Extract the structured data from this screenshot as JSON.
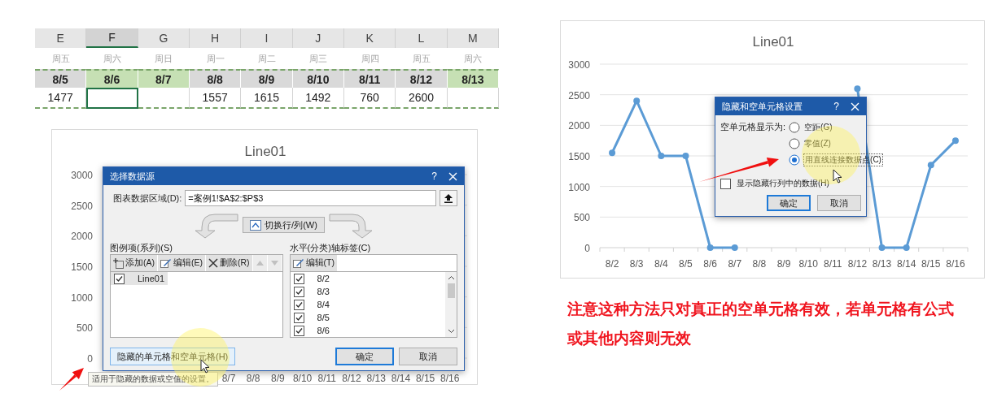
{
  "sheet": {
    "columns": [
      {
        "letter": "E",
        "weekday": "周五",
        "date": "8/5",
        "value": "1477",
        "color": "#d9d9d9",
        "selected": false
      },
      {
        "letter": "F",
        "weekday": "周六",
        "date": "8/6",
        "color": "#c6e0b4",
        "selected": true
      },
      {
        "letter": "G",
        "weekday": "周日",
        "date": "8/7",
        "color": "#c6e0b4",
        "selected": false
      },
      {
        "letter": "H",
        "weekday": "周一",
        "date": "8/8",
        "value": "1557",
        "color": "#d9d9d9",
        "selected": false
      },
      {
        "letter": "I",
        "weekday": "周二",
        "date": "8/9",
        "value": "1615",
        "color": "#d9d9d9",
        "selected": false
      },
      {
        "letter": "J",
        "weekday": "周三",
        "date": "8/10",
        "value": "1492",
        "color": "#d9d9d9",
        "selected": false
      },
      {
        "letter": "K",
        "weekday": "周四",
        "date": "8/11",
        "value": "760",
        "color": "#d9d9d9",
        "selected": false
      },
      {
        "letter": "L",
        "weekday": "周五",
        "date": "8/12",
        "value": "2600",
        "color": "#d9d9d9",
        "selected": false
      },
      {
        "letter": "M",
        "weekday": "周六",
        "date": "8/13",
        "color": "#c6e0b4",
        "selected": false
      }
    ]
  },
  "left_chart": {
    "title": "Line01",
    "y_labels": [
      "3000",
      "2500",
      "2000",
      "1500",
      "1000",
      "500",
      "0"
    ],
    "x_labels": [
      "8/7",
      "8/8",
      "8/9",
      "8/10",
      "8/11",
      "8/12",
      "8/13",
      "8/14",
      "8/15",
      "8/16"
    ]
  },
  "data_source_dialog": {
    "title": "选择数据源",
    "help": "?",
    "range_label": "图表数据区域(D):",
    "range_value": "=案例1!$A$2:$P$3",
    "switch_button": "切换行/列(W)",
    "series_heading": "图例项(系列)(S)",
    "series_buttons": [
      {
        "kind": "add",
        "label": "添加(A)",
        "disabled": false
      },
      {
        "kind": "edit",
        "label": "编辑(E)",
        "disabled": false
      },
      {
        "kind": "delete",
        "label": "删除(R)",
        "disabled": false
      },
      {
        "kind": "up",
        "disabled": true
      },
      {
        "kind": "down",
        "disabled": true
      }
    ],
    "series": [
      {
        "name": "Line01",
        "checked": true,
        "selected": true
      }
    ],
    "axis_heading": "水平(分类)轴标签(C)",
    "axis_buttons": [
      {
        "kind": "edit",
        "label": "编辑(T)",
        "disabled": false
      }
    ],
    "axis_labels": [
      {
        "label": "8/2",
        "checked": true
      },
      {
        "label": "8/3",
        "checked": true
      },
      {
        "label": "8/4",
        "checked": true
      },
      {
        "label": "8/5",
        "checked": true
      },
      {
        "label": "8/6",
        "checked": true
      }
    ],
    "hidden_cells_button": "隐藏的单元格和空单元格(H)",
    "ok": "确定",
    "cancel": "取消",
    "tooltip": "适用于隐藏的数据或空值的设置。"
  },
  "right_chart": {
    "chart_data": {
      "type": "line",
      "title": "Line01",
      "categories": [
        "8/2",
        "8/3",
        "8/4",
        "8/5",
        "8/6",
        "8/7",
        "8/8",
        "8/9",
        "8/10",
        "8/11",
        "8/12",
        "8/13",
        "8/14",
        "8/15",
        "8/16"
      ],
      "series": [
        {
          "color": "#5b9bd5",
          "marker": "circle",
          "values": [
            1550,
            2400,
            1500,
            1500,
            0,
            0,
            null,
            null,
            null,
            null,
            2600,
            0,
            0,
            1350,
            1750
          ]
        }
      ],
      "ylim": [
        0,
        3000
      ],
      "yticks": [
        0,
        500,
        1000,
        1500,
        2000,
        2500,
        3000
      ],
      "grid": true
    }
  },
  "hidden_cells_dialog": {
    "title": "隐藏和空单元格设置",
    "help": "?",
    "show_as_label": "空单元格显示为:",
    "options": [
      {
        "label": "空距(G)",
        "selected": false
      },
      {
        "label": "零值(Z)",
        "selected": false
      },
      {
        "label": "用直线连接数据点(C)",
        "selected": true
      }
    ],
    "show_hidden": {
      "label": "显示隐藏行列中的数据(H)",
      "checked": false
    },
    "ok": "确定",
    "cancel": "取消"
  },
  "note": "注意这种方法只对真正的空单元格有效，若单元格有公式或其他内容则无效"
}
